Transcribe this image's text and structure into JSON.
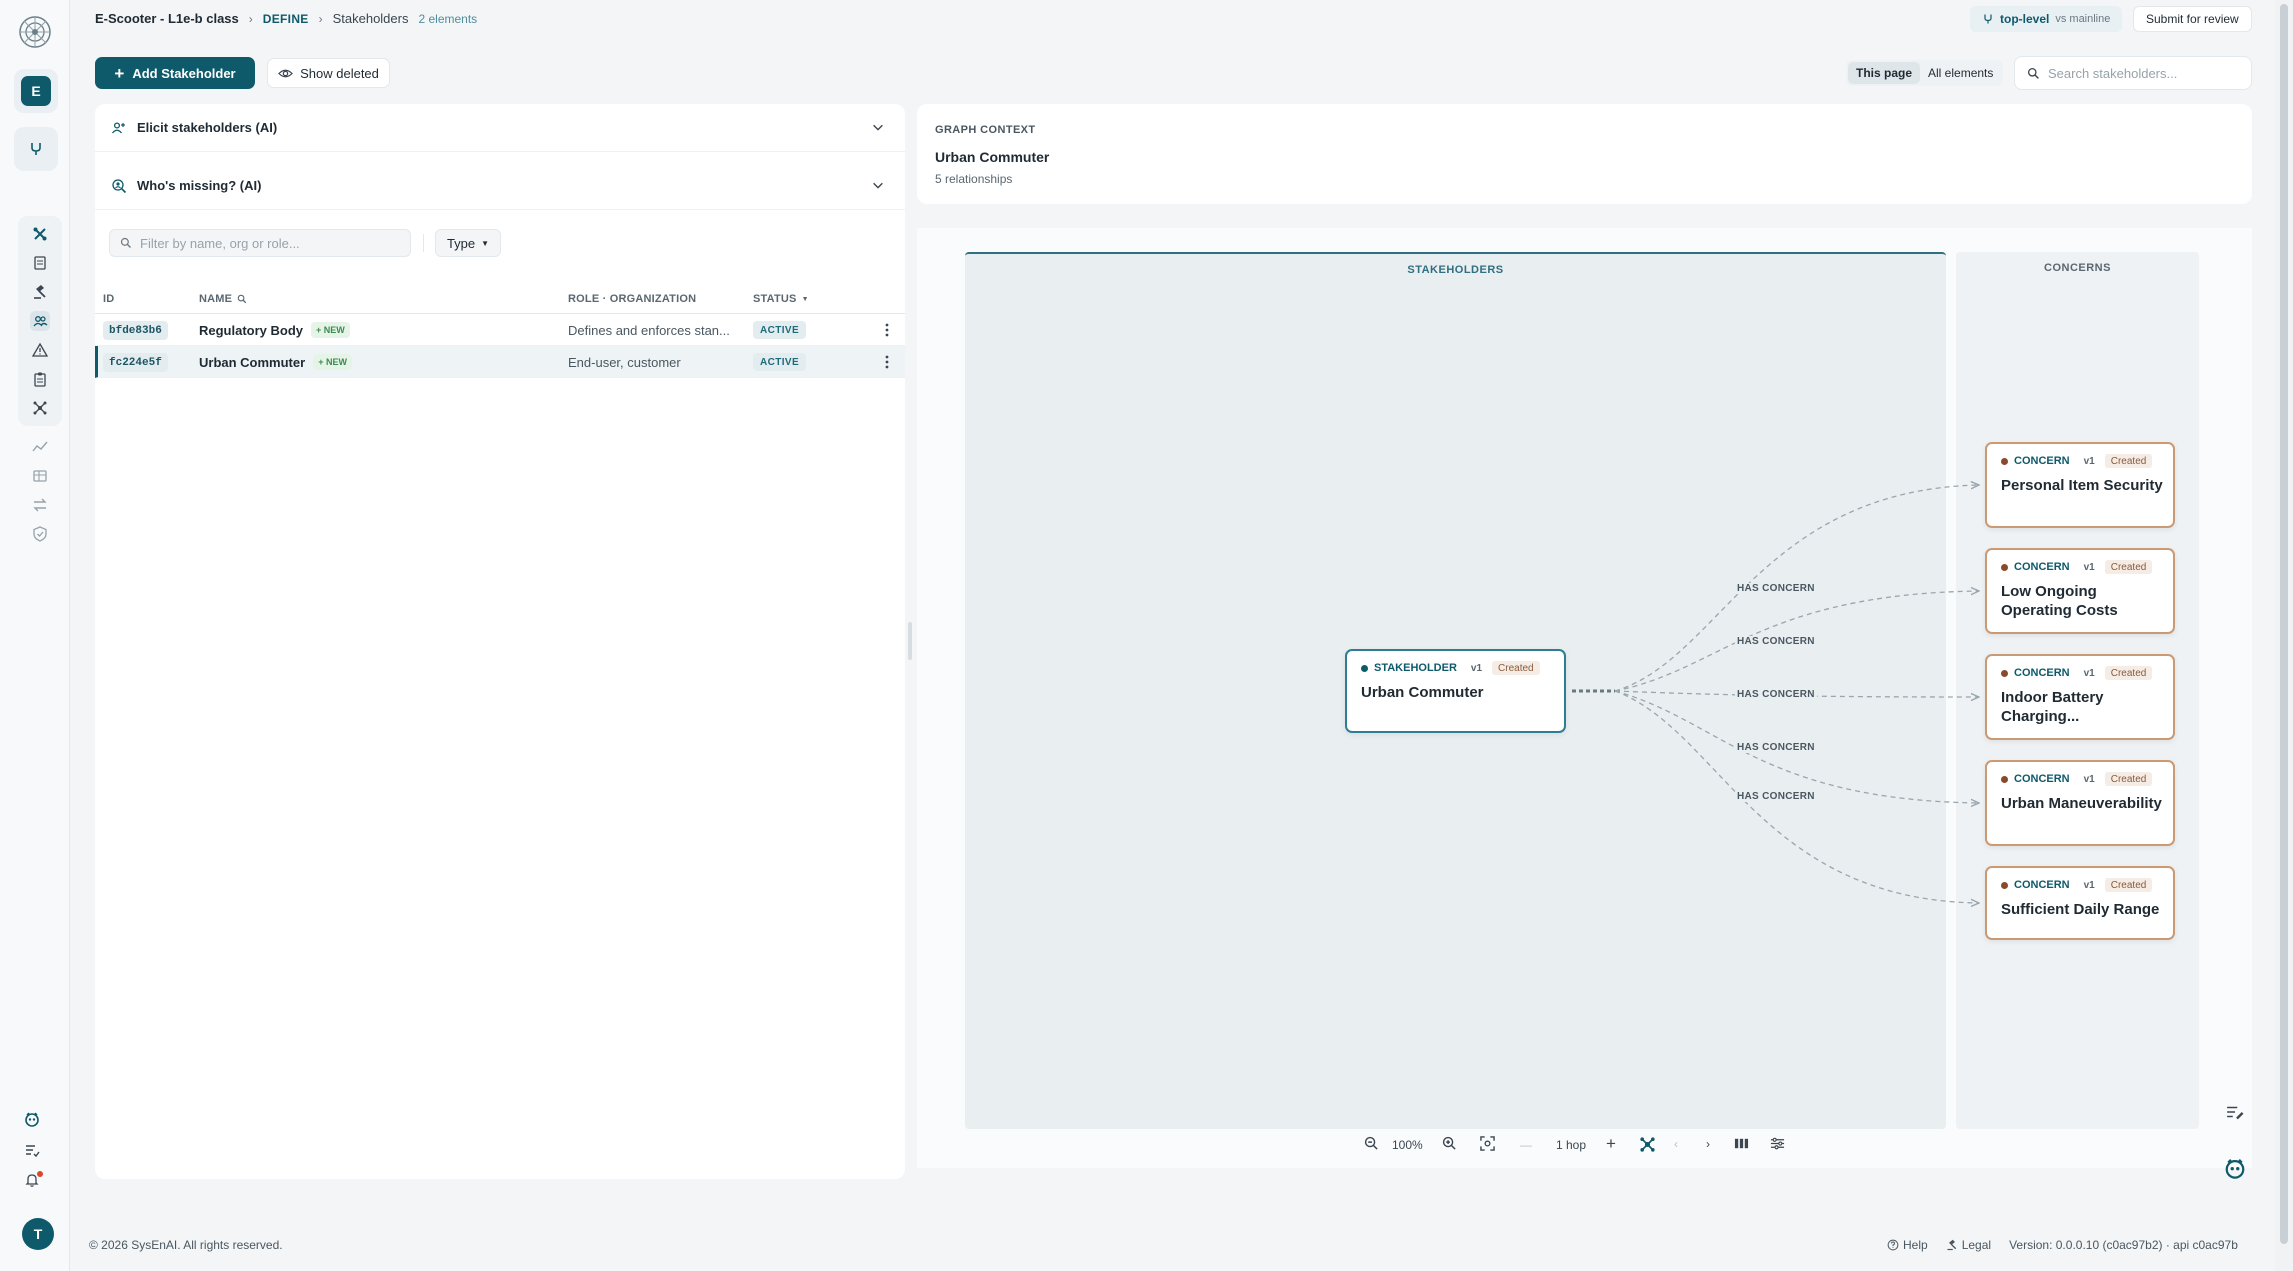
{
  "header": {
    "project": "E-Scooter - L1e-b class",
    "section": "DEFINE",
    "page": "Stakeholders",
    "count": "2 elements",
    "branch_name": "top-level",
    "branch_vs": "vs mainline",
    "submit_label": "Submit for review"
  },
  "rail": {
    "workspace_initial": "E",
    "user_initial": "T",
    "icons": [
      "logo-icon",
      "branch-icon",
      "tools-icon",
      "document-icon",
      "gavel-icon",
      "stakeholders-icon",
      "warning-icon",
      "clipboard-icon",
      "network-icon",
      "trend-icon",
      "table-icon",
      "swap-icon",
      "shield-icon",
      "assistant-icon",
      "checklist-icon",
      "bell-icon"
    ],
    "accent": "#0e5a6b"
  },
  "toolbar": {
    "add_label": "Add Stakeholder",
    "show_deleted_label": "Show deleted",
    "scope_this_page": "This page",
    "scope_all": "All elements",
    "search_placeholder": "Search stakeholders..."
  },
  "panels": {
    "elicit_label": "Elicit stakeholders (AI)",
    "missing_label": "Who's missing? (AI)"
  },
  "filters": {
    "filter_placeholder": "Filter by name, org or role...",
    "type_label": "Type"
  },
  "table": {
    "columns": {
      "id": "ID",
      "name": "NAME",
      "role": "ROLE · ORGANIZATION",
      "status": "STATUS"
    },
    "rows": [
      {
        "id": "bfde83b6",
        "name": "Regulatory Body",
        "badge": "+ NEW",
        "role": "Defines and enforces stan...",
        "status": "ACTIVE"
      },
      {
        "id": "fc224e5f",
        "name": "Urban Commuter",
        "badge": "+ NEW",
        "role": "End-user, customer",
        "status": "ACTIVE"
      }
    ]
  },
  "graph_context": {
    "label": "GRAPH CONTEXT",
    "title": "Urban Commuter",
    "subtitle": "5 relationships"
  },
  "graph": {
    "lane_stakeholders": "STAKEHOLDERS",
    "lane_concerns": "CONCERNS",
    "stakeholder_node": {
      "type": "STAKEHOLDER",
      "version": "v1",
      "state": "Created",
      "title": "Urban Commuter",
      "color": "#2f7d92"
    },
    "edge_label": "HAS CONCERN",
    "concerns": [
      {
        "type": "CONCERN",
        "version": "v1",
        "state": "Created",
        "title": "Personal Item Security"
      },
      {
        "type": "CONCERN",
        "version": "v1",
        "state": "Created",
        "title": "Low Ongoing Operating Costs"
      },
      {
        "type": "CONCERN",
        "version": "v1",
        "state": "Created",
        "title": "Indoor Battery Charging..."
      },
      {
        "type": "CONCERN",
        "version": "v1",
        "state": "Created",
        "title": "Urban Maneuverability"
      },
      {
        "type": "CONCERN",
        "version": "v1",
        "state": "Created",
        "title": "Sufficient Daily Range"
      }
    ],
    "concern_color": "#c99a74"
  },
  "graph_toolbar": {
    "zoom": "100%",
    "hops": "1 hop"
  },
  "footer": {
    "copyright": "© 2026 SysEnAI. All rights reserved.",
    "help": "Help",
    "legal": "Legal",
    "version": "Version: 0.0.0.10 (c0ac97b2) · api c0ac97b"
  }
}
